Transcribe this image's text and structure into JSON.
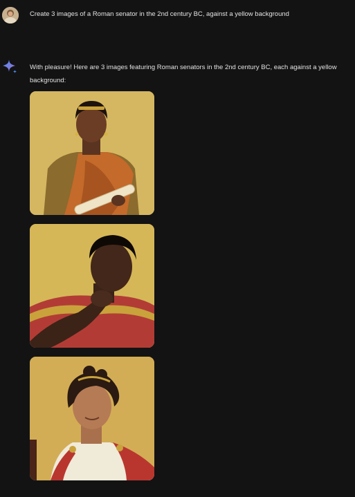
{
  "user_prompt": {
    "text": "Create 3 images of a Roman senator in the 2nd century BC, against a yellow background"
  },
  "assistant_reply": {
    "text": "With pleasure! Here are 3 images featuring Roman senators in the 2nd century BC, each against a yellow background:",
    "icon": "gemini-sparkle-icon"
  },
  "images": [
    {
      "subject": "woman-in-gold-headband-with-orange-toga-holding-scroll"
    },
    {
      "subject": "man-with-hand-on-chin-in-red-and-gold-garment"
    },
    {
      "subject": "smiling-woman-with-curly-hair-in-white-and-red-toga"
    }
  ],
  "colors": {
    "background": "#131314",
    "text": "#e3e3e3",
    "image_background": "#d8b75a",
    "sparkle_blue": "#4c8df6"
  }
}
